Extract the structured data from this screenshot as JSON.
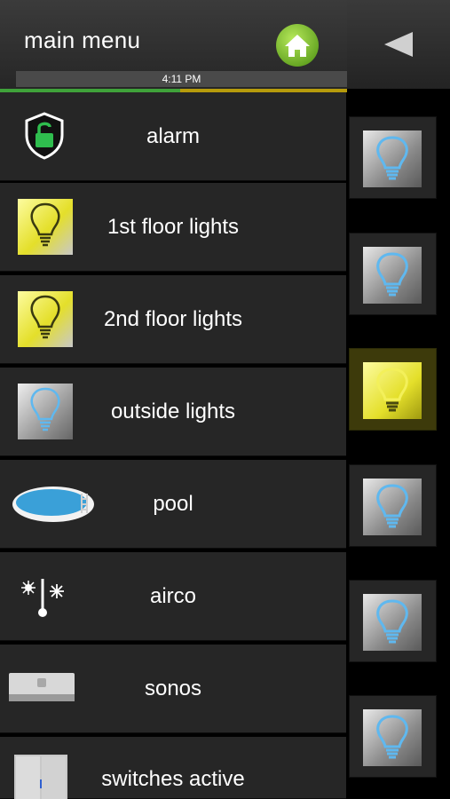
{
  "header": {
    "title": "main menu",
    "time": "4:11 PM",
    "progress": 0.52
  },
  "menu": [
    {
      "label": "alarm",
      "icon": "shield-lock-icon"
    },
    {
      "label": "1st floor lights",
      "icon": "lightbulb-on-icon"
    },
    {
      "label": "2nd floor lights",
      "icon": "lightbulb-on-icon"
    },
    {
      "label": "outside lights",
      "icon": "lightbulb-off-icon"
    },
    {
      "label": "pool",
      "icon": "pool-icon"
    },
    {
      "label": "airco",
      "icon": "sun-snow-thermometer-icon"
    },
    {
      "label": "sonos",
      "icon": "speaker-icon"
    },
    {
      "label": "switches active",
      "icon": "wall-switch-icon"
    }
  ],
  "right_tiles": [
    {
      "state": "off"
    },
    {
      "state": "off"
    },
    {
      "state": "on"
    },
    {
      "state": "off"
    },
    {
      "state": "off"
    },
    {
      "state": "off"
    }
  ],
  "colors": {
    "accent_green": "#3fa23a",
    "accent_yellow": "#b69b0c",
    "bulb_on": "#f3f05a",
    "bulb_off": "#5fb8ef"
  }
}
